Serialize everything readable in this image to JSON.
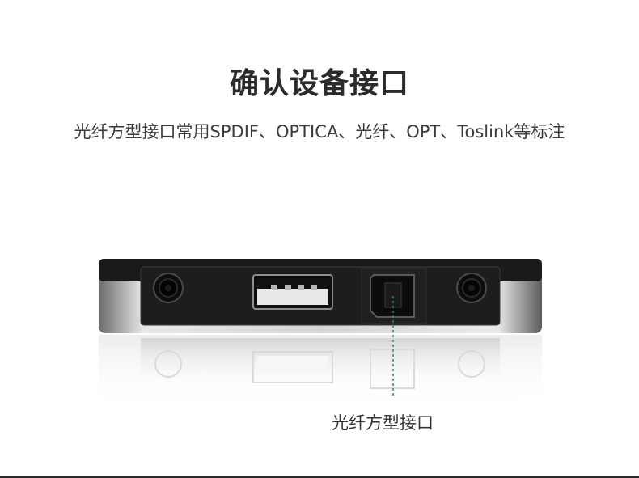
{
  "heading": "确认设备接口",
  "subheading": "光纤方型接口常用SPDIF、OPTICA、光纤、OPT、Toslink等标注",
  "callout_label": "光纤方型接口",
  "colors": {
    "title": "#2b2b2b",
    "device_body": "#1b1b1b",
    "device_shell": "#c9c9c9",
    "callout_line": "#2e8b57"
  }
}
